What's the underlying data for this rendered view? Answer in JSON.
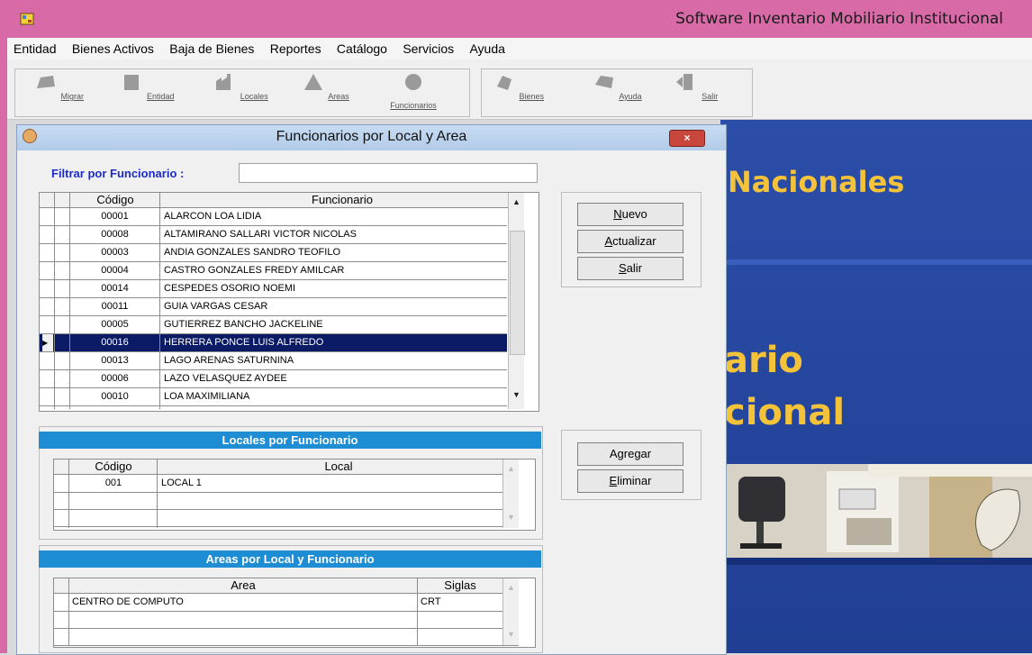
{
  "app": {
    "title": "Software Inventario Mobiliario Institucional"
  },
  "menu": [
    "Entidad",
    "Bienes Activos",
    "Baja de Bienes",
    "Reportes",
    "Catálogo",
    "Servicios",
    "Ayuda"
  ],
  "toolbar": {
    "migrar": "Migrar",
    "entidad": "Entidad",
    "locales": "Locales",
    "areas": "Areas",
    "funcionarios": "Funcionarios",
    "bienes": "Bienes",
    "ayuda": "Ayuda",
    "salir": "Salir"
  },
  "background": {
    "line1": "Nacionales",
    "line2": "ario",
    "line3": "cional"
  },
  "dialog": {
    "title": "Funcionarios por Local y Area",
    "close_glyph": "×",
    "filter_label": "Filtrar por Funcionario :",
    "filter_value": ""
  },
  "funcionarios": {
    "col_codigo": "Código",
    "col_funcionario": "Funcionario",
    "rows": [
      {
        "codigo": "00001",
        "nombre": "ALARCON LOA LIDIA"
      },
      {
        "codigo": "00008",
        "nombre": "ALTAMIRANO SALLARI VICTOR NICOLAS"
      },
      {
        "codigo": "00003",
        "nombre": "ANDIA GONZALES SANDRO TEOFILO"
      },
      {
        "codigo": "00004",
        "nombre": "CASTRO GONZALES FREDY AMILCAR"
      },
      {
        "codigo": "00014",
        "nombre": "CESPEDES OSORIO NOEMI"
      },
      {
        "codigo": "00011",
        "nombre": "GUIA VARGAS CESAR"
      },
      {
        "codigo": "00005",
        "nombre": "GUTIERREZ BANCHO JACKELINE"
      },
      {
        "codigo": "00016",
        "nombre": "HERRERA PONCE LUIS ALFREDO"
      },
      {
        "codigo": "00013",
        "nombre": "LAGO ARENAS SATURNINA"
      },
      {
        "codigo": "00006",
        "nombre": "LAZO VELASQUEZ AYDEE"
      },
      {
        "codigo": "00010",
        "nombre": "LOA MAXIMILIANA"
      }
    ]
  },
  "buttons": {
    "nuevo": {
      "pre": "",
      "mn": "N",
      "post": "uevo"
    },
    "actualizar": {
      "pre": "",
      "mn": "A",
      "post": "ctualizar"
    },
    "salir": {
      "pre": "",
      "mn": "S",
      "post": "alir"
    },
    "agregar": {
      "pre": "A",
      "mn": "g",
      "post": "regar"
    },
    "eliminar": {
      "pre": "",
      "mn": "E",
      "post": "liminar"
    }
  },
  "locales": {
    "header": "Locales por Funcionario",
    "col_codigo": "Código",
    "col_local": "Local",
    "rows": [
      {
        "codigo": "001",
        "local": "LOCAL 1"
      }
    ]
  },
  "areas": {
    "header": "Areas por Local y Funcionario",
    "col_area": "Area",
    "col_siglas": "Siglas",
    "rows": [
      {
        "area": "CENTRO DE COMPUTO",
        "siglas": "CRT"
      }
    ]
  }
}
